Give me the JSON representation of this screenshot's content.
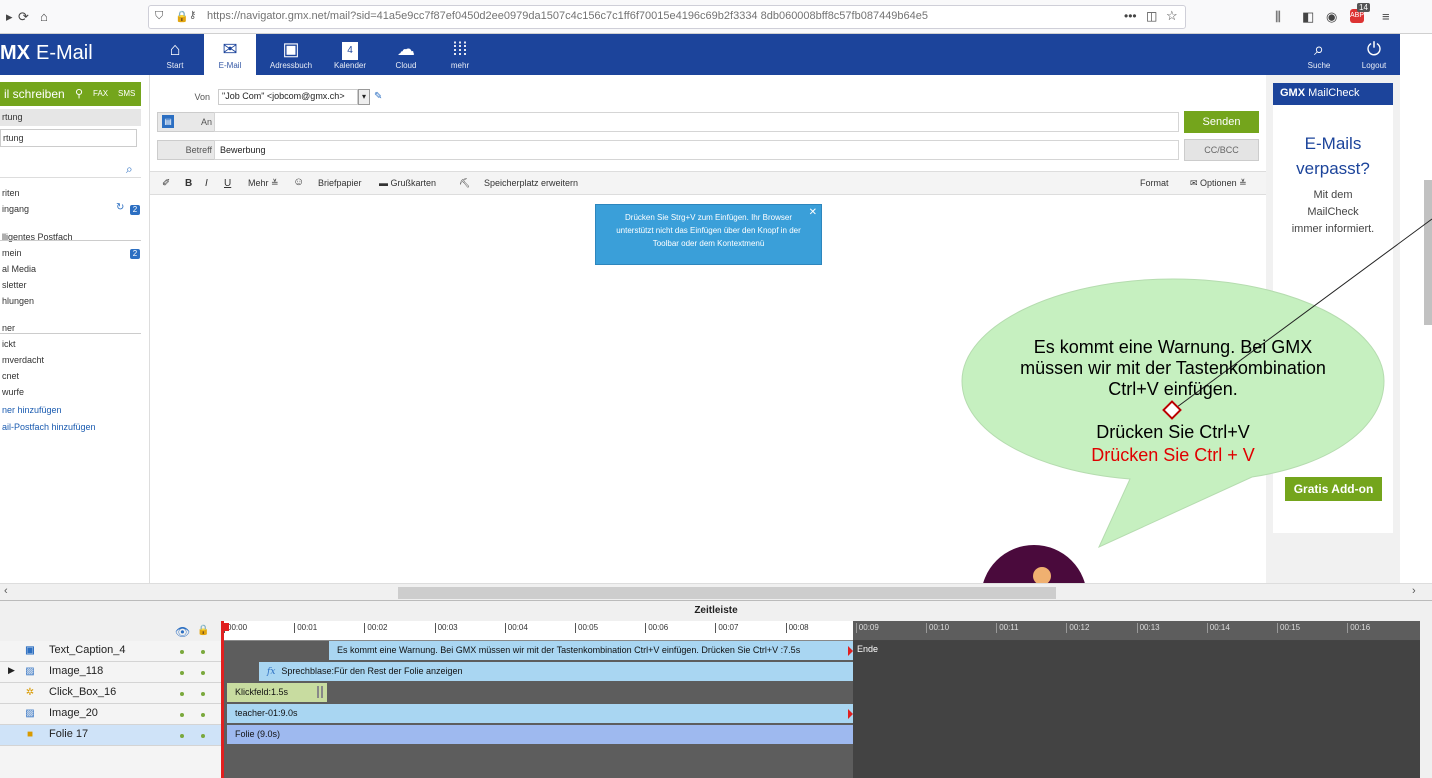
{
  "browser": {
    "url": "https://navigator.gmx.net/mail?sid=41a5e9cc7f87ef0450d2ee0979da1507c4c156c7c1ff6f70015e4196c69b2f3334 8db060008bff8c57fb087449b64e5",
    "badge_count": "14"
  },
  "header": {
    "logo_mark": "MX",
    "logo_text": "E-Mail",
    "nav": [
      {
        "label": "Start",
        "icon": "home-icon"
      },
      {
        "label": "E-Mail",
        "icon": "envelope-icon"
      },
      {
        "label": "Adressbuch",
        "icon": "contacts-icon"
      },
      {
        "label": "Kalender",
        "icon": "calendar-icon",
        "date": "4"
      },
      {
        "label": "Cloud",
        "icon": "cloud-icon"
      },
      {
        "label": "mehr",
        "icon": "grid-icon"
      }
    ],
    "search_label": "Suche",
    "logout_label": "Logout"
  },
  "sidebar": {
    "compose_label": "il schreiben",
    "fax_label": "FAX",
    "sms_label": "SMS",
    "items": [
      {
        "label": "rtung"
      },
      {
        "label": "rtung"
      },
      {
        "label": "riten"
      },
      {
        "label": "ingang",
        "badge": "2"
      },
      {
        "label": "lligentes Postfach"
      },
      {
        "label": "mein",
        "badge": "2"
      },
      {
        "label": "al Media"
      },
      {
        "label": "sletter"
      },
      {
        "label": "hlungen"
      },
      {
        "label": "ner"
      },
      {
        "label": "ickt"
      },
      {
        "label": "mverdacht"
      },
      {
        "label": "cnet"
      },
      {
        "label": "wurfe"
      },
      {
        "label": "ner hinzufügen"
      },
      {
        "label": "ail-Postfach hinzufügen"
      }
    ]
  },
  "compose": {
    "from_label": "Von",
    "from_value": "\"Job Com\" <jobcom@gmx.ch>",
    "to_label": "An",
    "subject_label": "Betreff",
    "subject_value": "Bewerbung",
    "send_label": "Senden",
    "cc_label": "CC/BCC",
    "toolbar": {
      "bold": "B",
      "italic": "I",
      "underline": "U",
      "more": "Mehr",
      "stationery": "Briefpapier",
      "cards": "Grußkarten",
      "storage": "Speicherplatz erweitern",
      "format": "Format",
      "options": "Optionen"
    },
    "tooltip": "Drücken Sie Strg+V zum Einfügen. Ihr Browser unterstützt nicht das Einfügen über den Knopf in der Toolbar oder dem Kontextmenü"
  },
  "ad": {
    "brand": "GMX",
    "product": "MailCheck",
    "title_line1": "E-Mails",
    "title_line2": "verpasst?",
    "text_line1": "Mit dem",
    "text_line2": "MailCheck",
    "text_line3": "immer informiert.",
    "button": "Gratis Add-on"
  },
  "bubble": {
    "line1": "Es kommt eine Warnung. Bei GMX",
    "line2": "müssen wir mit der Tastenkombination",
    "line3": "Ctrl+V einfügen.",
    "line4": "Drücken Sie Ctrl+V",
    "line5": "Drücken Sie Ctrl + V",
    "line5_color": "#e00000",
    "fill": "#c6f0c0"
  },
  "timeline": {
    "title": "Zeitleiste",
    "ticks": [
      "00:00",
      "00:01",
      "00:02",
      "00:03",
      "00:04",
      "00:05",
      "00:06",
      "00:07",
      "00:08",
      "00:09",
      "00:10",
      "00:11",
      "00:12",
      "00:13",
      "00:14",
      "00:15",
      "00:16"
    ],
    "end_label": "Ende",
    "layers": [
      {
        "name": "Text_Caption_4",
        "icon": "caption-icon",
        "bar": "Es kommt eine Warnung. Bei GMX müssen wir mit der Tastenkombination Ctrl+V einfügen.  Drücken Sie Ctrl+V :7.5s"
      },
      {
        "name": "Image_118",
        "icon": "image-icon",
        "bar": "Sprechblase:Für den Rest der Folie anzeigen",
        "fx": "fx"
      },
      {
        "name": "Click_Box_16",
        "icon": "click-icon",
        "bar": "Klickfeld:1.5s"
      },
      {
        "name": "Image_20",
        "icon": "image-icon",
        "bar": "teacher-01:9.0s"
      },
      {
        "name": "Folie 17",
        "icon": "slide-icon",
        "bar": "Folie (9.0s)"
      }
    ]
  }
}
